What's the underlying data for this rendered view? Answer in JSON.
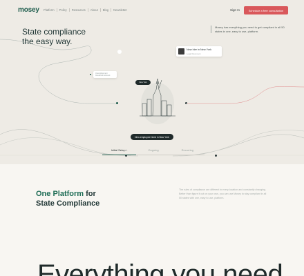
{
  "nav": {
    "logo": "mosey",
    "links": [
      "Platform",
      "Policy",
      "Resources",
      "About",
      "Blog",
      "Newsletter"
    ],
    "signin": "Sign In",
    "cta": "Schedule a free consultation"
  },
  "hero": {
    "headline_line1": "State compliance",
    "headline_line2": "the easy way.",
    "right_copy": "Mosey has everything you need to get compliant in all 50 states in one, easy to use, platform.",
    "popup_title": "New hire in New York",
    "popup_sub": "Legal Document",
    "popup_left_line1": "Unemployment",
    "popup_left_line2": "Insurance Account",
    "tooltip": "New York",
    "pill": "New employee hired in New York",
    "tabs": [
      "Initial Setup",
      "Ongoing",
      "Recurring"
    ],
    "active_tab_suffix": "↓"
  },
  "section2": {
    "title_accent": "One Platform",
    "title_rest_1": " for",
    "title_line2": "State Compliance",
    "copy": "The rules of compliance are different in every location and constantly changing. Better than figure it out on your own, you can use Mosey to stay compliant in all 50 states with one, easy to use, platform."
  },
  "section3": {
    "big_heading": "Everything you need"
  },
  "colors": {
    "accent_green": "#1d5c4c",
    "cta_red": "#d9585b",
    "dark": "#1f2a2a"
  }
}
